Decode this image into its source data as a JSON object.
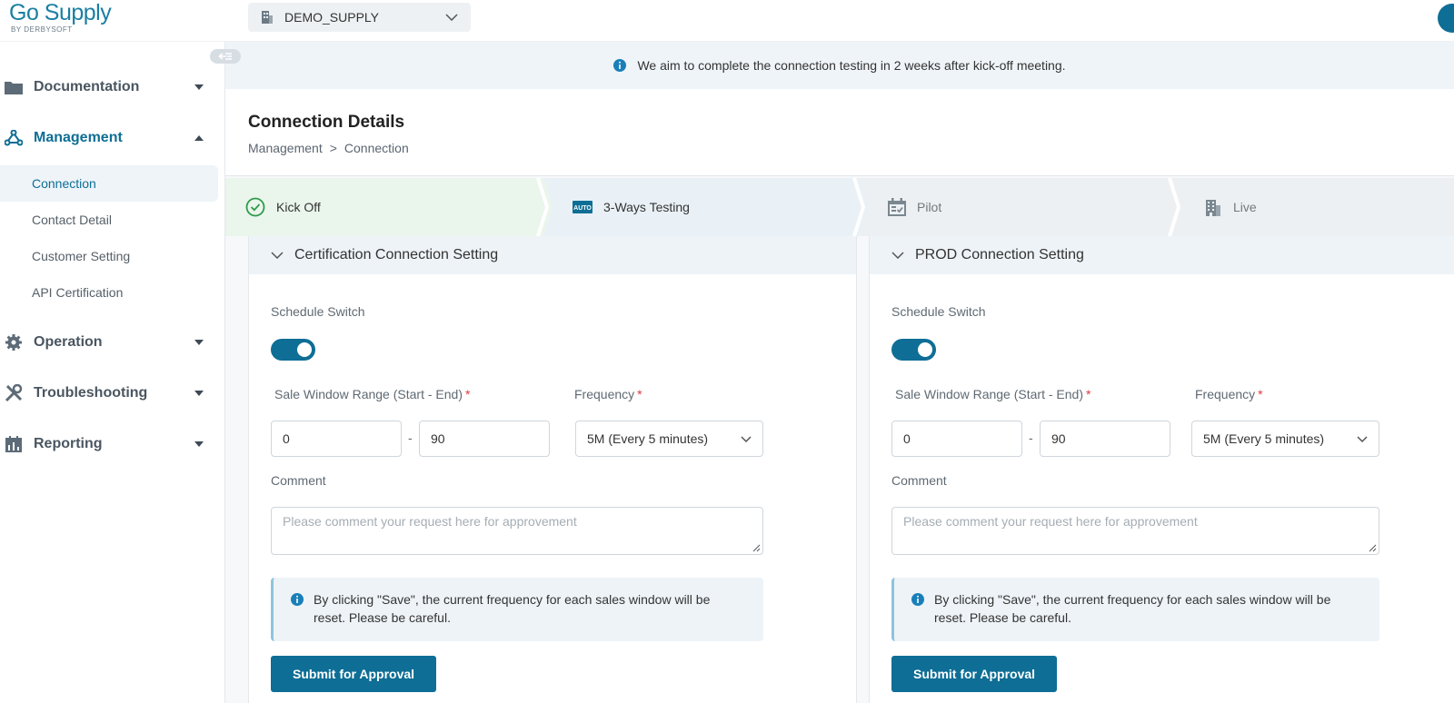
{
  "app": {
    "logo_main": "Go Supply",
    "logo_sub": "BY DERBYSOFT",
    "tenant": "DEMO_SUPPLY"
  },
  "sidebar": {
    "groups": [
      {
        "label": "Documentation",
        "icon": "folder-icon"
      },
      {
        "label": "Management",
        "icon": "network-icon"
      },
      {
        "label": "Operation",
        "icon": "gear-icon"
      },
      {
        "label": "Troubleshooting",
        "icon": "tools-icon"
      },
      {
        "label": "Reporting",
        "icon": "report-icon"
      }
    ],
    "management_items": [
      "Connection",
      "Contact Detail",
      "Customer Setting",
      "API Certification"
    ]
  },
  "banner": {
    "text": "We aim to complete the connection testing in 2 weeks after kick-off meeting."
  },
  "page": {
    "title": "Connection Details",
    "breadcrumb": [
      "Management",
      ">",
      "Connection"
    ]
  },
  "steps": [
    {
      "label": "Kick Off",
      "icon": "check-circle-icon",
      "status": "done"
    },
    {
      "label": "3-Ways Testing",
      "icon": "auto-icon",
      "status": "current"
    },
    {
      "label": "Pilot",
      "icon": "calendar-check-icon",
      "status": "pending"
    },
    {
      "label": "Live",
      "icon": "building-icon",
      "status": "pending"
    }
  ],
  "panels": [
    {
      "title": "Certification Connection Setting",
      "schedule_label": "Schedule Switch",
      "schedule_on": true,
      "range_label": "Sale Window Range (Start - End)",
      "range_req": "*",
      "range_start": "0",
      "range_dash": "-",
      "range_end": "90",
      "freq_label": "Frequency",
      "freq_req": "*",
      "freq_value": "5M (Every 5 minutes)",
      "comment_label": "Comment",
      "comment_placeholder": "Please comment your request here for approvement",
      "notice_line1": "By clicking \"Save\", the current frequency for each sales window will be",
      "notice_line2": "reset. Please be careful.",
      "submit_label": "Submit for Approval"
    },
    {
      "title": "PROD Connection Setting",
      "schedule_label": "Schedule Switch",
      "schedule_on": true,
      "range_label": "Sale Window Range (Start - End)",
      "range_req": "*",
      "range_start": "0",
      "range_dash": "-",
      "range_end": "90",
      "freq_label": "Frequency",
      "freq_req": "*",
      "freq_value": "5M (Every 5 minutes)",
      "comment_label": "Comment",
      "comment_placeholder": "Please comment your request here for approvement",
      "notice_line1": "By clicking \"Save\", the current frequency for each sales window will be",
      "notice_line2": "reset. Please be careful.",
      "submit_label": "Submit for Approval"
    }
  ],
  "colors": {
    "primary": "#0e6e95",
    "step_done_bg": "#eaf5ec",
    "step_current_bg": "#e9f1f7",
    "step_pending_bg": "#edf0f3",
    "success": "#2e9b4a"
  }
}
